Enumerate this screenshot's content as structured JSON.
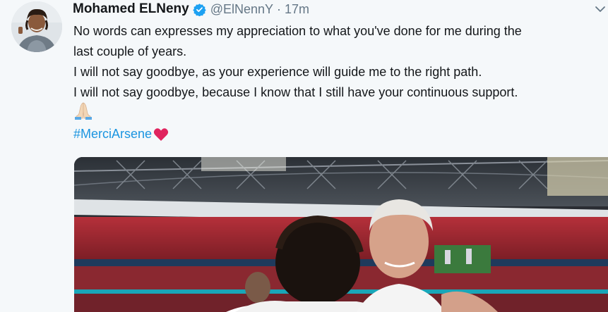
{
  "tweet": {
    "author": {
      "display_name": "Mohamed ELNeny",
      "handle": "@ElNennY",
      "verified": true
    },
    "separator": "·",
    "time": "17m",
    "lines": [
      "No words can expresses my appreciation to what you've done for me during the",
      "last couple of years.",
      "I will not say goodbye, as your experience will guide me to the right path.",
      "I will not say goodbye, because I know that I still have your continuous support."
    ],
    "emoji": "folded-hands",
    "hashtag": "#MerciArsene",
    "hashtag_emoji": "red-heart"
  },
  "colors": {
    "background": "#f5f8fa",
    "text": "#14171a",
    "secondary": "#657786",
    "link": "#1b95e0",
    "verified": "#1da1f2",
    "heart": "#e0245e"
  },
  "icons": [
    "verified-badge-icon",
    "chevron-down-icon",
    "folded-hands-icon",
    "red-heart-icon"
  ]
}
